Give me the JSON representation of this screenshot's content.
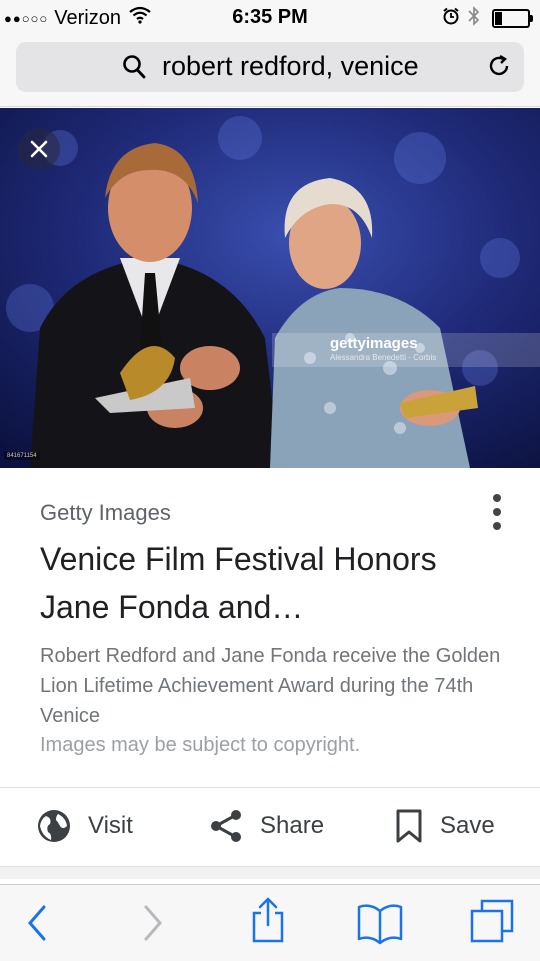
{
  "status_bar": {
    "signal": "●●○○○",
    "carrier": "Verizon",
    "time": "6:35 PM",
    "battery_level": 0.2
  },
  "url_bar": {
    "query": "robert redford, venice"
  },
  "image": {
    "watermark": "gettyimages",
    "watermark_credit": "Alessandra Benedetti - Corbis",
    "image_id": "841671154"
  },
  "result": {
    "source": "Getty Images",
    "title": "Venice Film Festival Honors Jane Fonda and…",
    "description": "Robert Redford and Jane Fonda receive the Golden Lion Lifetime Achievement Award during the 74th Venice",
    "copyright": "Images may be subject to copyright."
  },
  "actions": {
    "visit": "Visit",
    "share": "Share",
    "save": "Save"
  },
  "colors": {
    "accent": "#1a73e8",
    "toolbar_icon": "#1a73e8"
  }
}
